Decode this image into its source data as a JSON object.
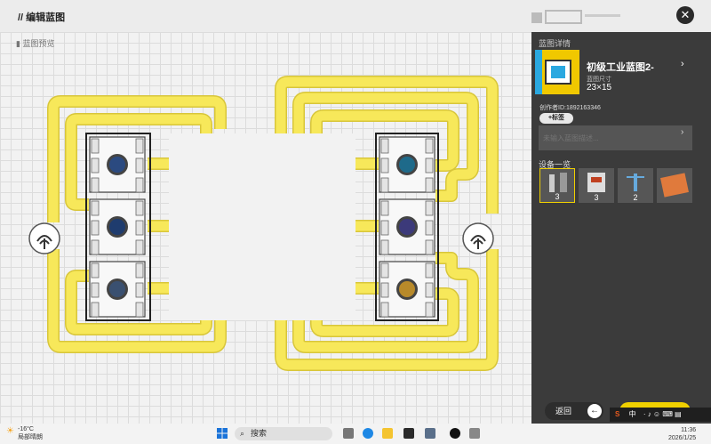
{
  "window": {
    "title": "// 编辑蓝图",
    "close_icon": "close-icon"
  },
  "canvas": {
    "label": "▮ 蓝图预览"
  },
  "panel": {
    "label": "蓝图详情",
    "blueprint": {
      "name": "初级工业蓝图2-",
      "size_label": "蓝图尺寸",
      "size": "23×15"
    },
    "creator": "创作者ID:1892163346",
    "tag_button": "+标签",
    "description_placeholder": "未输入蓝图描述...",
    "devices_label": "设备一览",
    "devices": [
      {
        "name": "refining-unit",
        "count": "3"
      },
      {
        "name": "crushing-unit",
        "count": "3"
      },
      {
        "name": "power-pylon",
        "count": "2"
      },
      {
        "name": "floor-tile",
        "count": ""
      }
    ]
  },
  "buttons": {
    "back": "返回"
  },
  "ime": {
    "label": "中"
  },
  "taskbar": {
    "weather_temp": "-16°C",
    "weather_desc": "局部晴朗",
    "search": "搜索",
    "time": "11:36",
    "date": "2026/1/25"
  },
  "colors": {
    "belt": "#f7e85a",
    "belt_edge": "#d8c63a",
    "accent": "#f0d000",
    "panel_bg": "#3b3b3b"
  }
}
